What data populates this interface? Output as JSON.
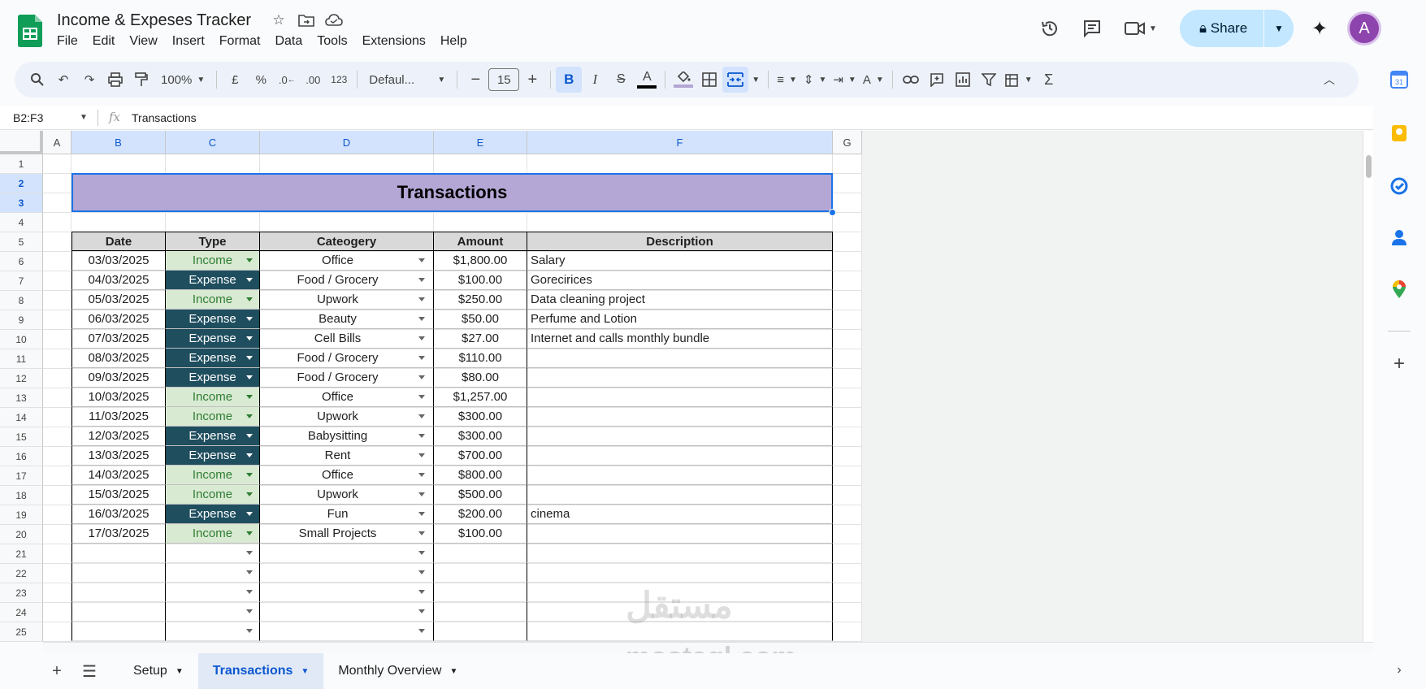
{
  "app": {
    "title": "Income & Expeses Tracker",
    "menu": [
      "File",
      "Edit",
      "View",
      "Insert",
      "Format",
      "Data",
      "Tools",
      "Extensions",
      "Help"
    ],
    "share_label": "Share",
    "avatar_initial": "A"
  },
  "toolbar": {
    "zoom": "100%",
    "currency": "£",
    "percent": "%",
    "dec_decrease": ".0←",
    "dec_increase": ".00",
    "number_format": "123",
    "font": "Defaul...",
    "font_size": "15"
  },
  "formula_bar": {
    "name_box": "B2:F3",
    "value": "Transactions"
  },
  "columns": [
    "A",
    "B",
    "C",
    "D",
    "E",
    "F",
    "G"
  ],
  "selected_columns": [
    "B",
    "C",
    "D",
    "E",
    "F"
  ],
  "rows": [
    "1",
    "2",
    "3",
    "4",
    "5",
    "6",
    "7",
    "8",
    "9",
    "10",
    "11",
    "12",
    "13",
    "14",
    "15",
    "16",
    "17",
    "18",
    "19",
    "20",
    "21",
    "22",
    "23",
    "24",
    "25"
  ],
  "selected_rows": [
    "2",
    "3"
  ],
  "sheet_title": "Transactions",
  "table": {
    "headers": [
      "Date",
      "Type",
      "Cateogery",
      "Amount",
      "Description"
    ],
    "rows": [
      {
        "date": "03/03/2025",
        "type": "Income",
        "category": "Office",
        "amount": "$1,800.00",
        "description": "Salary"
      },
      {
        "date": "04/03/2025",
        "type": "Expense",
        "category": "Food / Grocery",
        "amount": "$100.00",
        "description": "Gorecirices"
      },
      {
        "date": "05/03/2025",
        "type": "Income",
        "category": "Upwork",
        "amount": "$250.00",
        "description": "Data cleaning project"
      },
      {
        "date": "06/03/2025",
        "type": "Expense",
        "category": "Beauty",
        "amount": "$50.00",
        "description": "Perfume and Lotion"
      },
      {
        "date": "07/03/2025",
        "type": "Expense",
        "category": "Cell Bills",
        "amount": "$27.00",
        "description": "Internet and calls monthly bundle"
      },
      {
        "date": "08/03/2025",
        "type": "Expense",
        "category": "Food / Grocery",
        "amount": "$110.00",
        "description": ""
      },
      {
        "date": "09/03/2025",
        "type": "Expense",
        "category": "Food / Grocery",
        "amount": "$80.00",
        "description": ""
      },
      {
        "date": "10/03/2025",
        "type": "Income",
        "category": "Office",
        "amount": "$1,257.00",
        "description": ""
      },
      {
        "date": "11/03/2025",
        "type": "Income",
        "category": "Upwork",
        "amount": "$300.00",
        "description": ""
      },
      {
        "date": "12/03/2025",
        "type": "Expense",
        "category": "Babysitting",
        "amount": "$300.00",
        "description": ""
      },
      {
        "date": "13/03/2025",
        "type": "Expense",
        "category": "Rent",
        "amount": "$700.00",
        "description": ""
      },
      {
        "date": "14/03/2025",
        "type": "Income",
        "category": "Office",
        "amount": "$800.00",
        "description": ""
      },
      {
        "date": "15/03/2025",
        "type": "Income",
        "category": "Upwork",
        "amount": "$500.00",
        "description": ""
      },
      {
        "date": "16/03/2025",
        "type": "Expense",
        "category": "Fun",
        "amount": "$200.00",
        "description": "cinema"
      },
      {
        "date": "17/03/2025",
        "type": "Income",
        "category": "Small Projects",
        "amount": "$100.00",
        "description": ""
      }
    ],
    "blank_rows": 5
  },
  "sheets": [
    {
      "name": "Setup",
      "active": false
    },
    {
      "name": "Transactions",
      "active": true
    },
    {
      "name": "Monthly Overview",
      "active": false
    }
  ],
  "watermark": {
    "latin": "mostaql.com",
    "arabic": "مستقل"
  },
  "colors": {
    "title_band": "#b4a7d6",
    "income_bg": "#d9ead3",
    "income_text": "#2e7d32",
    "expense_bg": "#1f4e5f",
    "selection": "#1a73e8",
    "share_bg": "#c2e7ff",
    "avatar_bg": "#8e44ad"
  }
}
